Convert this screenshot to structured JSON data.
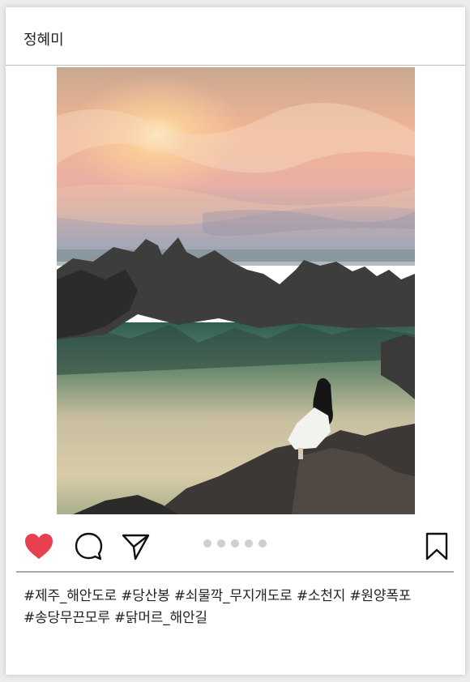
{
  "post": {
    "username": "정혜미",
    "caption_line1": "#제주_해안도로 #당산봉 #쇠물깍_무지개도로 #소천지 #원양폭포",
    "caption_line2": "#송당무끈모루 #닭머르_해안길"
  },
  "carousel": {
    "total": 5,
    "active": 0
  },
  "actions": {
    "like_icon": "heart-icon",
    "comment_icon": "comment-icon",
    "share_icon": "send-icon",
    "save_icon": "bookmark-icon"
  },
  "colors": {
    "like": "#e8404f",
    "divider": "#a8a8a8",
    "dot": "#cfcfcf"
  }
}
